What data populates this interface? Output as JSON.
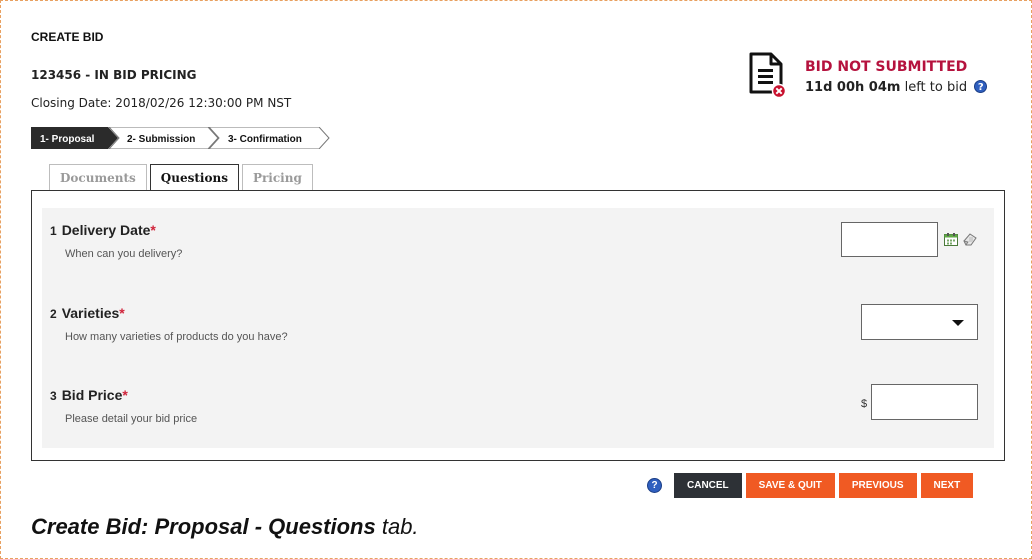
{
  "page": {
    "title": "CREATE BID",
    "bid_ref": "123456 - IN BID PRICING",
    "closing_label": "Closing Date:",
    "closing_value": "2018/02/26 12:30:00 PM NST"
  },
  "status": {
    "title": "BID NOT SUBMITTED",
    "remaining": "11d 00h 04m",
    "remaining_suffix": "left to bid",
    "help_glyph": "?",
    "colors": {
      "title": "#b5123e"
    }
  },
  "steps": [
    {
      "label": "1- Proposal",
      "active": true
    },
    {
      "label": "2- Submission",
      "active": false
    },
    {
      "label": "3- Confirmation",
      "active": false
    }
  ],
  "tabs": [
    {
      "label": "Documents",
      "active": false
    },
    {
      "label": "Questions",
      "active": true
    },
    {
      "label": "Pricing",
      "active": false
    }
  ],
  "questions": [
    {
      "number": "1",
      "title": "Delivery Date",
      "required_mark": "*",
      "description": "When can you delivery?",
      "input_type": "date",
      "value": ""
    },
    {
      "number": "2",
      "title": "Varieties",
      "required_mark": "*",
      "description": "How many varieties of products do you have?",
      "input_type": "select",
      "value": ""
    },
    {
      "number": "3",
      "title": "Bid Price",
      "required_mark": "*",
      "description": "Please detail your bid price",
      "input_type": "currency",
      "currency_symbol": "$",
      "value": ""
    }
  ],
  "actions": {
    "help_glyph": "?",
    "cancel": "CANCEL",
    "save_quit": "SAVE & QUIT",
    "previous": "PREVIOUS",
    "next": "NEXT",
    "colors": {
      "dark": "#2d3136",
      "accent": "#f05a23"
    }
  },
  "caption": {
    "bold": "Create Bid: Proposal - Questions",
    "rest": " tab."
  }
}
